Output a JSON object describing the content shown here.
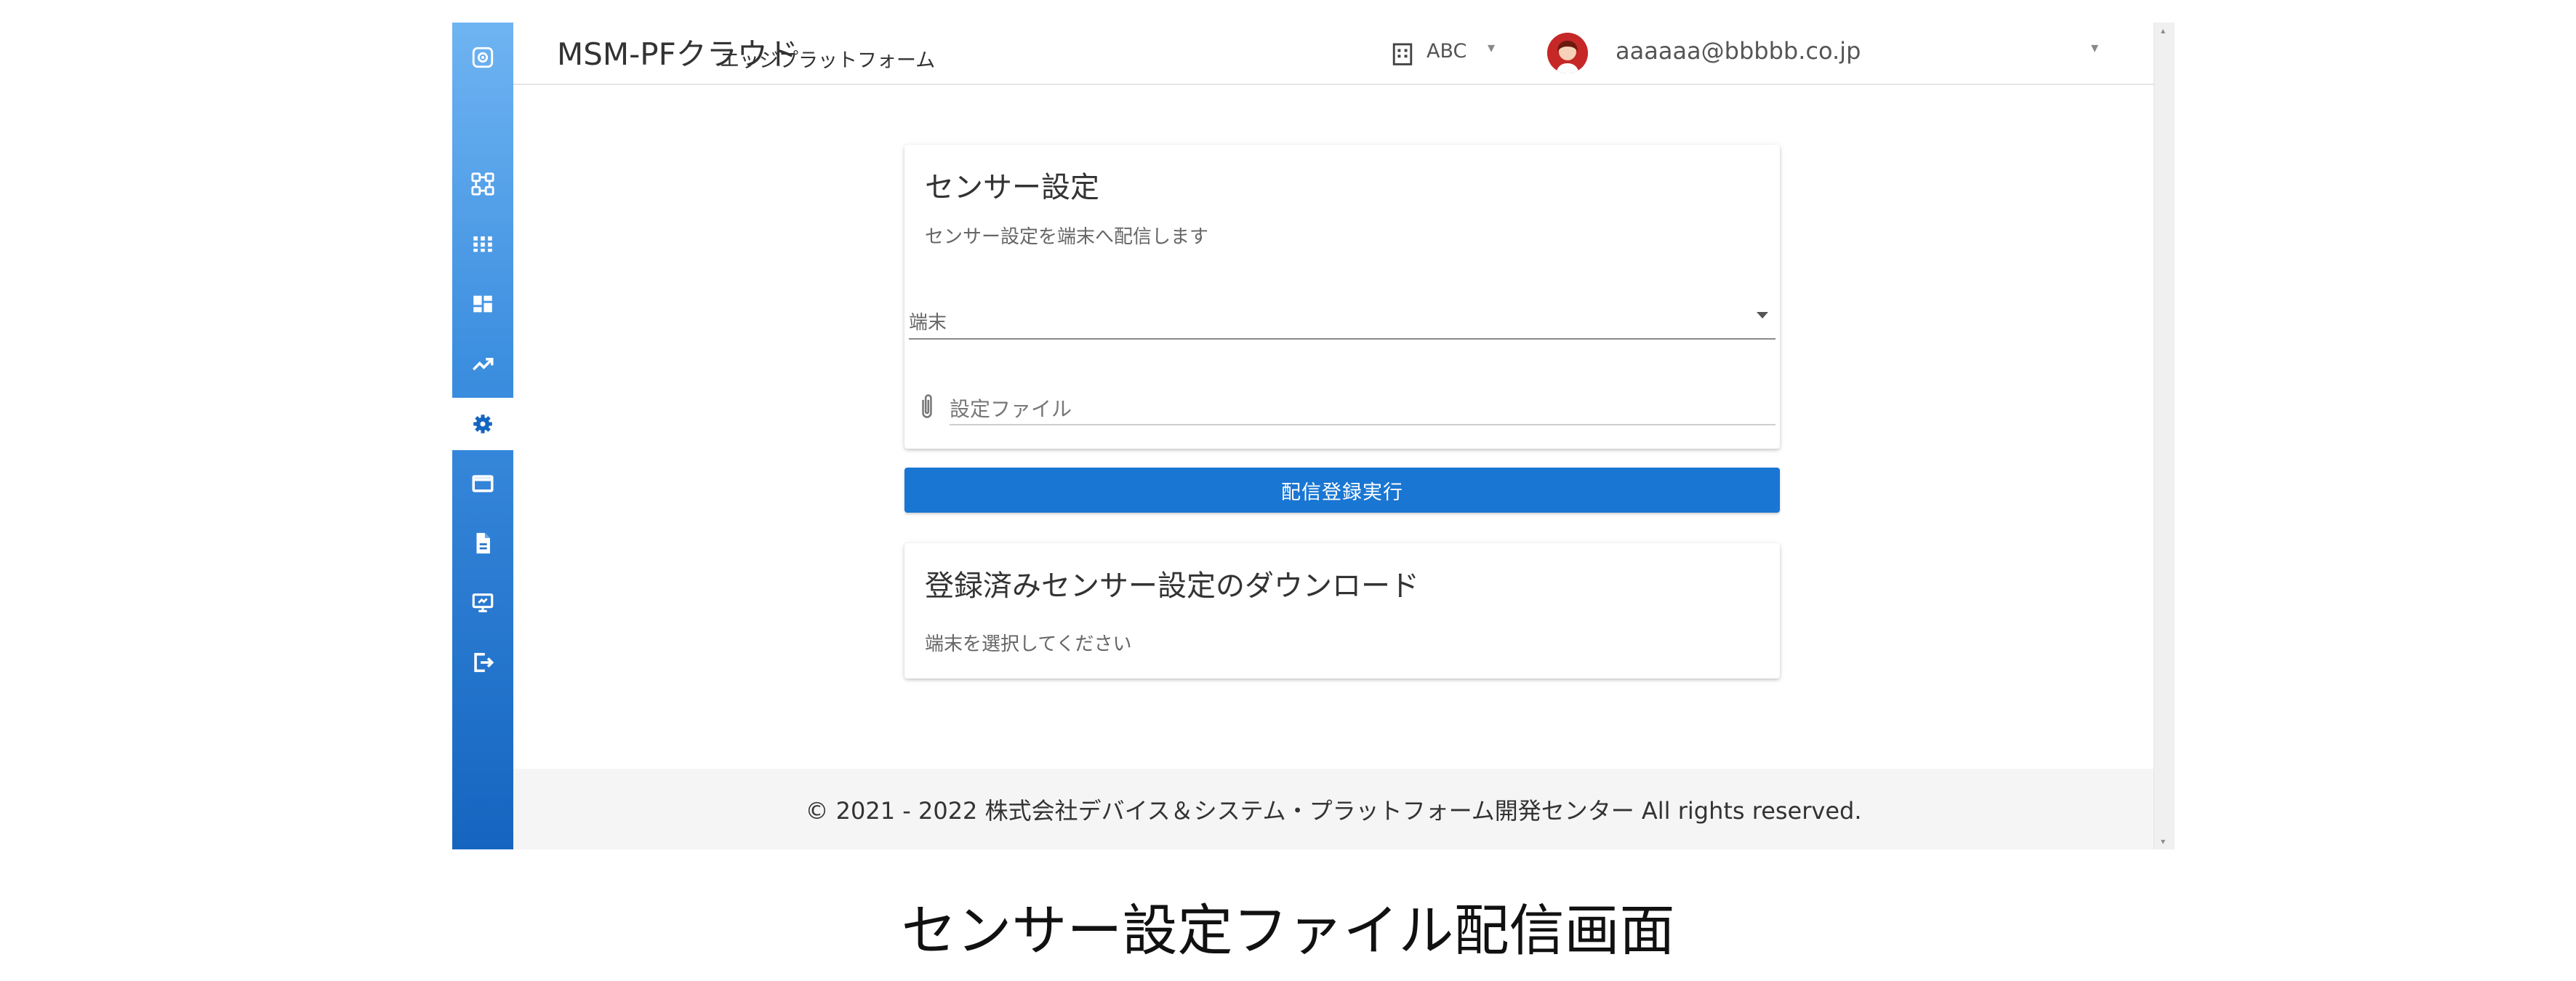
{
  "header": {
    "app_title": "MSM-PFクラウド",
    "app_subtitle": "エッジプラットフォーム",
    "tenant": "ABC",
    "user_email": "aaaaaa@bbbbb.co.jp"
  },
  "sidebar": {
    "items": [
      {
        "icon": "logo-icon"
      },
      {
        "icon": "device-network-icon"
      },
      {
        "icon": "apps-grid-icon"
      },
      {
        "icon": "dashboard-icon"
      },
      {
        "icon": "trending-up-icon"
      },
      {
        "icon": "settings-icon",
        "active": true
      },
      {
        "icon": "window-icon"
      },
      {
        "icon": "file-icon"
      },
      {
        "icon": "monitor-icon"
      },
      {
        "icon": "logout-icon"
      }
    ]
  },
  "sensor_settings": {
    "title": "センサー設定",
    "description": "センサー設定を端末へ配信します",
    "device_select_label": "端末",
    "file_input_label": "設定ファイル",
    "submit_label": "配信登録実行"
  },
  "download": {
    "title": "登録済みセンサー設定のダウンロード",
    "message": "端末を選択してください"
  },
  "footer": {
    "copyright": "© 2021 - 2022 株式会社デバイス＆システム・プラットフォーム開発センター All rights reserved."
  },
  "caption": "センサー設定ファイル配信画面",
  "colors": {
    "primary": "#1976d2",
    "sidebar_top": "#6fb4f2",
    "sidebar_bottom": "#1565c0"
  }
}
